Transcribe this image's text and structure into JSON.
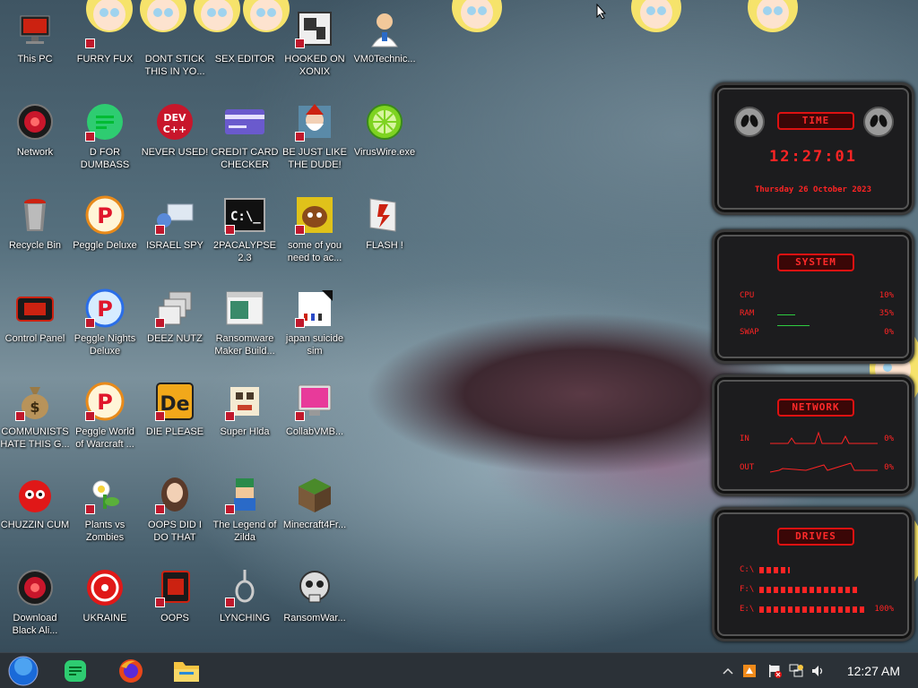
{
  "desktop": {
    "icons": [
      {
        "label": "This PC",
        "icon": "monitor-icon"
      },
      {
        "label": "FURRY FUX",
        "icon": "image-icon"
      },
      {
        "label": "DONT STICK THIS IN YO...",
        "icon": "image-icon"
      },
      {
        "label": "SEX EDITOR",
        "icon": "app-icon"
      },
      {
        "label": "HOOKED ON XONIX",
        "icon": "game-icon"
      },
      {
        "label": "VM0Technic...",
        "icon": "doctor-icon"
      },
      {
        "label": "Network",
        "icon": "network-icon"
      },
      {
        "label": "D FOR DUMBASS",
        "icon": "chat-icon"
      },
      {
        "label": "NEVER USED!",
        "icon": "dev-cpp-icon"
      },
      {
        "label": "CREDIT CARD CHECKER",
        "icon": "credit-card-icon"
      },
      {
        "label": "BE JUST LIKE THE DUDE!",
        "icon": "dwarf-icon"
      },
      {
        "label": "VirusWire.exe",
        "icon": "lime-icon"
      },
      {
        "label": "Recycle Bin",
        "icon": "recycle-bin-icon"
      },
      {
        "label": "Peggle Deluxe",
        "icon": "peggle-icon"
      },
      {
        "label": "ISRAEL SPY",
        "icon": "spy-icon"
      },
      {
        "label": "2PACALYPSE 2.3",
        "icon": "terminal-icon"
      },
      {
        "label": "some of you need to ac...",
        "icon": "dog-icon"
      },
      {
        "label": "FLASH !",
        "icon": "flash-icon"
      },
      {
        "label": "Control Panel",
        "icon": "control-panel-icon"
      },
      {
        "label": "Peggle Nights Deluxe",
        "icon": "peggle-icon"
      },
      {
        "label": "DEEZ NUTZ",
        "icon": "windows-stack-icon"
      },
      {
        "label": "Ransomware Maker Build...",
        "icon": "window-app-icon"
      },
      {
        "label": "japan suicide sim",
        "icon": "document-icon"
      },
      {
        "label": "COMMUNISTS HATE THIS G...",
        "icon": "money-bag-icon"
      },
      {
        "label": "Peggle World of Warcraft ...",
        "icon": "peggle-icon"
      },
      {
        "label": "DIE PLEASE",
        "icon": "de-icon"
      },
      {
        "label": "Super Hlda",
        "icon": "pixel-character-icon"
      },
      {
        "label": "CollabVMB...",
        "icon": "monitor-pink-icon"
      },
      {
        "label": "CHUZZIN CUM",
        "icon": "chuzzle-icon"
      },
      {
        "label": "Plants vs Zombies",
        "icon": "plant-icon"
      },
      {
        "label": "OOPS DID I DO THAT",
        "icon": "portrait-icon"
      },
      {
        "label": "The Legend of Zilda",
        "icon": "pixel-hero-icon"
      },
      {
        "label": "Minecraft4Fr...",
        "icon": "grass-block-icon"
      },
      {
        "label": "Download Black Ali...",
        "icon": "network-icon"
      },
      {
        "label": "UKRAINE",
        "icon": "radiation-icon"
      },
      {
        "label": "OOPS",
        "icon": "red-app-icon"
      },
      {
        "label": "LYNCHING",
        "icon": "noose-icon"
      },
      {
        "label": "RansomWar...",
        "icon": "skull-icon"
      }
    ]
  },
  "widgets": {
    "time": {
      "title": "TIME",
      "clock": "12:27:01",
      "date": "Thursday 26 October 2023"
    },
    "system": {
      "title": "SYSTEM",
      "rows": [
        {
          "label": "CPU",
          "value": "10%"
        },
        {
          "label": "RAM",
          "value": "35%"
        },
        {
          "label": "SWAP",
          "value": "0%"
        }
      ]
    },
    "network": {
      "title": "NETWORK",
      "rows": [
        {
          "label": "IN",
          "value": "0%"
        },
        {
          "label": "OUT",
          "value": "0%"
        }
      ]
    },
    "drives": {
      "title": "DRIVES",
      "rows": [
        {
          "label": "C:\\",
          "value": ""
        },
        {
          "label": "F:\\",
          "value": ""
        },
        {
          "label": "E:\\",
          "value": "100%"
        }
      ]
    }
  },
  "taskbar": {
    "clock": "12:27 AM",
    "pinned": [
      "start-orb-icon",
      "chat-icon",
      "firefox-icon",
      "file-explorer-icon"
    ],
    "tray": [
      "chevron-up-icon",
      "app-tray-icon",
      "flag-icon",
      "network-tray-icon",
      "volume-icon"
    ]
  },
  "colors": {
    "accent_red": "#ff2424",
    "taskbar_bg": "#2b3137"
  }
}
